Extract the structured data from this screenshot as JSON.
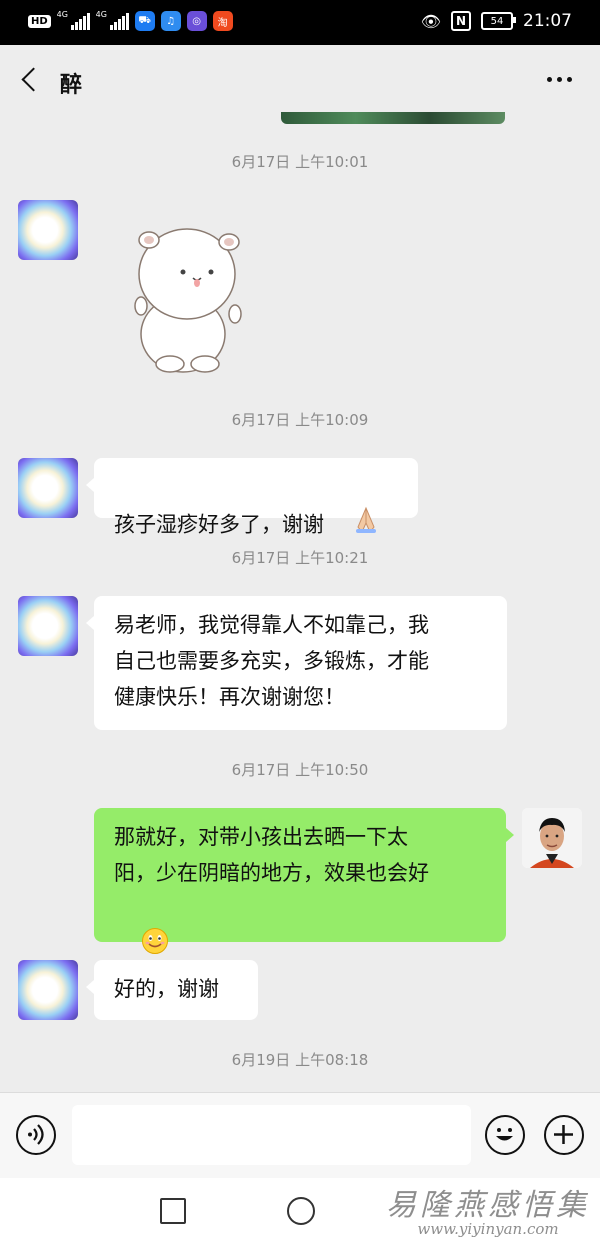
{
  "status_bar": {
    "hd_label": "HD",
    "net1": "4G",
    "net2": "4G",
    "apps": [
      {
        "icon": "delivery-app-icon",
        "color": "#1e7cf2",
        "glyph": "⛟"
      },
      {
        "icon": "music-app-icon",
        "color": "#2f8cf0",
        "glyph": "♫"
      },
      {
        "icon": "purple-app-icon",
        "color": "#6a4fd8",
        "glyph": "◎"
      },
      {
        "icon": "shopping-app-icon",
        "color": "#f04a1f",
        "glyph": "淘"
      }
    ],
    "battery": "54",
    "time": "21:07"
  },
  "header": {
    "title": "醉",
    "back_icon": "chevron-left-icon",
    "more_icon": "more-dots-icon"
  },
  "timestamps": [
    "6月17日 上午10:01",
    "6月17日 上午10:09",
    "6月17日 上午10:21",
    "6月17日 上午10:50",
    "6月19日 上午08:18"
  ],
  "messages": [
    {
      "side": "left",
      "type": "sticker",
      "sticker": "white-hamster-sticker"
    },
    {
      "side": "left",
      "type": "text",
      "text": "孩子湿疹好多了，谢谢",
      "emoji": "pray-emoji"
    },
    {
      "side": "left",
      "type": "text",
      "text": "易老师，我觉得靠人不如靠己，我\n自己也需要多充实，多锻炼，才能\n健康快乐！再次谢谢您！"
    },
    {
      "side": "right",
      "type": "text",
      "text": "那就好，对带小孩出去晒一下太\n阳，少在阴暗的地方，效果也会好",
      "emoji": "smile-emoji"
    },
    {
      "side": "left",
      "type": "text",
      "text": "好的，谢谢"
    }
  ],
  "input_bar": {
    "voice_icon": "voice-icon",
    "emoji_icon": "emoji-icon",
    "plus_icon": "plus-icon",
    "placeholder": ""
  },
  "watermark": {
    "cn": "易隆燕感悟集",
    "url": "www.yiyinyan.com"
  },
  "colors": {
    "chat_bg": "#ededed",
    "sent_bubble": "#95ec69",
    "received_bubble": "#ffffff"
  }
}
